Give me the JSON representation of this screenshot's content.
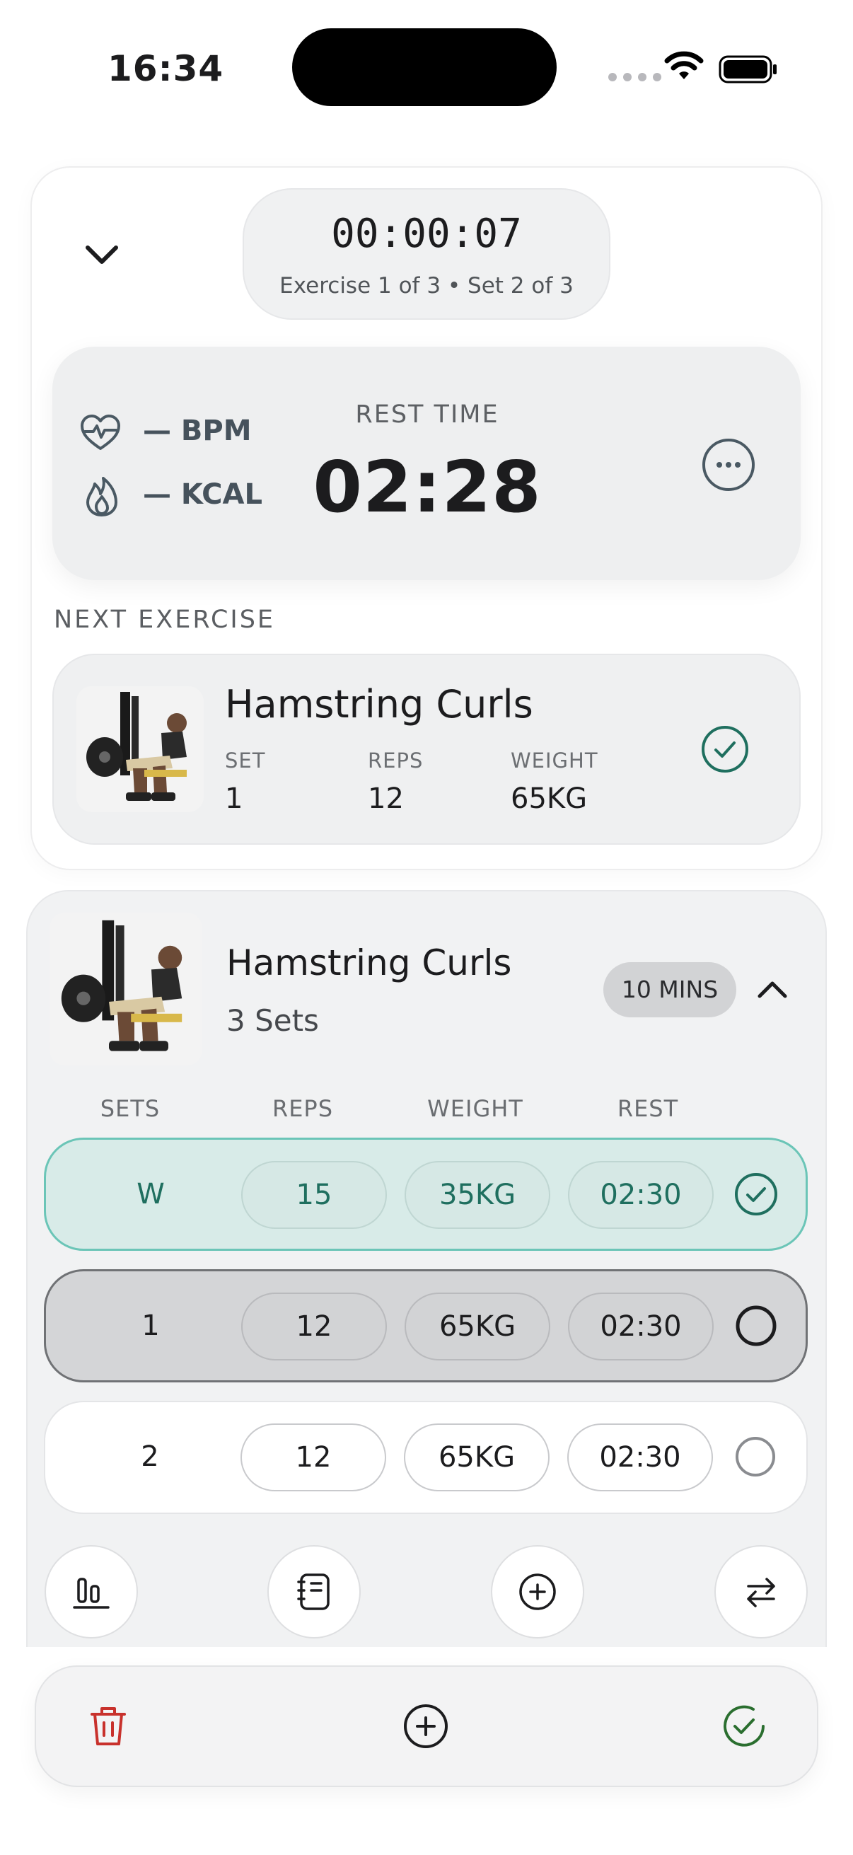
{
  "status_bar": {
    "time": "16:34",
    "wifi_icon": "wifi-icon",
    "battery_icon": "battery-icon"
  },
  "workout": {
    "elapsed": "00:00:07",
    "progress_text": "Exercise 1 of 3 • Set 2 of 3"
  },
  "metrics": {
    "bpm": "— BPM",
    "kcal": "— KCAL",
    "rest_label": "REST TIME",
    "rest_value": "02:28"
  },
  "next_exercise": {
    "section_label": "NEXT EXERCISE",
    "title": "Hamstring Curls",
    "set_label": "SET",
    "set_value": "1",
    "reps_label": "REPS",
    "reps_value": "12",
    "weight_label": "WEIGHT",
    "weight_value": "65KG"
  },
  "current_exercise": {
    "title": "Hamstring Curls",
    "sets_summary": "3 Sets",
    "duration_badge": "10 MINS",
    "headers": {
      "sets": "SETS",
      "reps": "REPS",
      "weight": "WEIGHT",
      "rest": "REST"
    },
    "rows": [
      {
        "set": "W",
        "reps": "15",
        "weight": "35KG",
        "rest": "02:30",
        "status": "completed"
      },
      {
        "set": "1",
        "reps": "12",
        "weight": "65KG",
        "rest": "02:30",
        "status": "active"
      },
      {
        "set": "2",
        "reps": "12",
        "weight": "65KG",
        "rest": "02:30",
        "status": "pending"
      }
    ]
  },
  "colors": {
    "accent_green": "#1f6f5f",
    "delete_red": "#c8312c",
    "finish_green": "#2a6e2f"
  }
}
